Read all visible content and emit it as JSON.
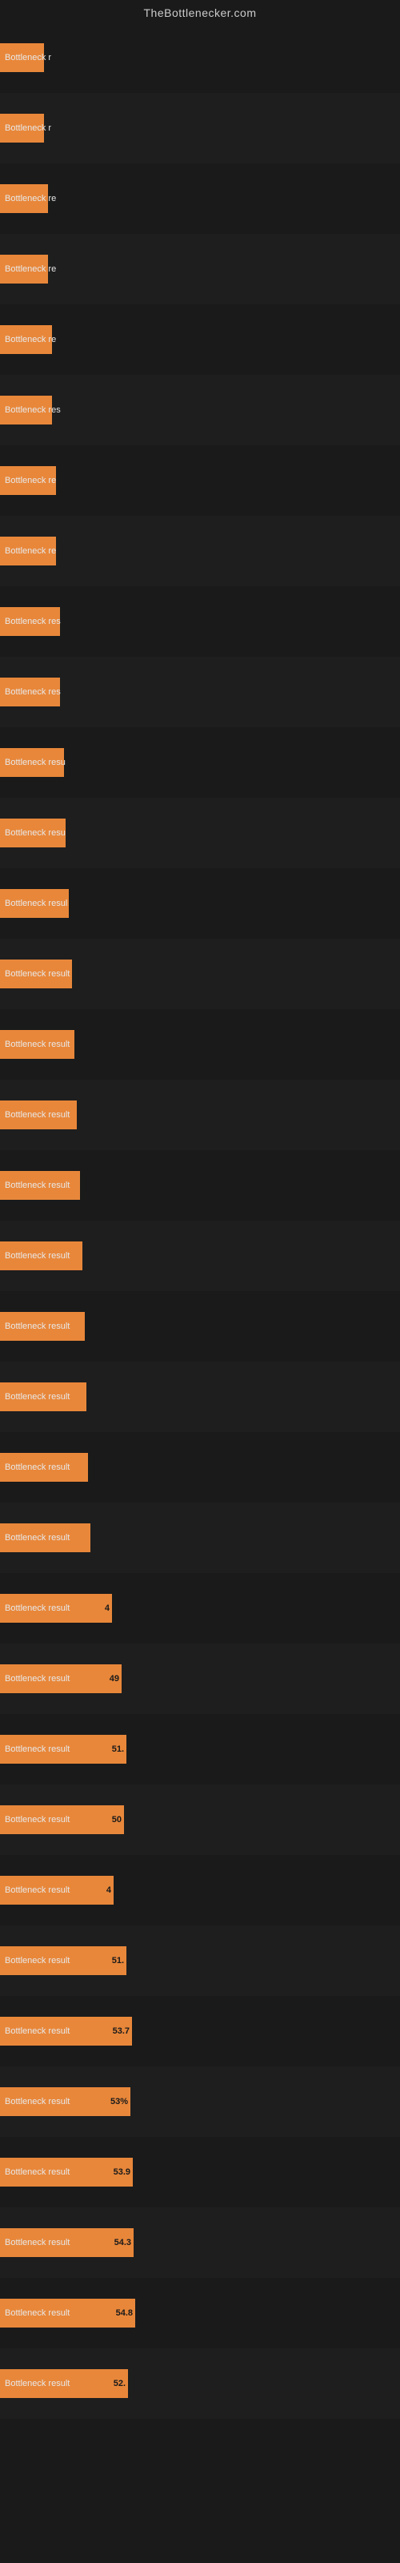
{
  "site": {
    "title": "TheBottlenecker.com"
  },
  "bars": [
    {
      "label": "Bottleneck r",
      "value": null,
      "width": 55
    },
    {
      "label": "Bottleneck r",
      "value": null,
      "width": 55
    },
    {
      "label": "Bottleneck re",
      "value": null,
      "width": 60
    },
    {
      "label": "Bottleneck re",
      "value": null,
      "width": 60
    },
    {
      "label": "Bottleneck re",
      "value": null,
      "width": 65
    },
    {
      "label": "Bottleneck res",
      "value": null,
      "width": 65
    },
    {
      "label": "Bottleneck re",
      "value": null,
      "width": 70
    },
    {
      "label": "Bottleneck re",
      "value": null,
      "width": 70
    },
    {
      "label": "Bottleneck res",
      "value": null,
      "width": 75
    },
    {
      "label": "Bottleneck res",
      "value": null,
      "width": 75
    },
    {
      "label": "Bottleneck resu",
      "value": null,
      "width": 80
    },
    {
      "label": "Bottleneck resu",
      "value": null,
      "width": 82
    },
    {
      "label": "Bottleneck resul",
      "value": null,
      "width": 86
    },
    {
      "label": "Bottleneck result",
      "value": null,
      "width": 90
    },
    {
      "label": "Bottleneck result",
      "value": null,
      "width": 93
    },
    {
      "label": "Bottleneck result",
      "value": null,
      "width": 96
    },
    {
      "label": "Bottleneck result",
      "value": null,
      "width": 100
    },
    {
      "label": "Bottleneck result",
      "value": null,
      "width": 103
    },
    {
      "label": "Bottleneck result",
      "value": null,
      "width": 106
    },
    {
      "label": "Bottleneck result",
      "value": null,
      "width": 108
    },
    {
      "label": "Bottleneck result",
      "value": null,
      "width": 110
    },
    {
      "label": "Bottleneck result",
      "value": null,
      "width": 113
    },
    {
      "label": "Bottleneck result",
      "value": "4",
      "width": 140
    },
    {
      "label": "Bottleneck result",
      "value": "49",
      "width": 152
    },
    {
      "label": "Bottleneck result",
      "value": "51.",
      "width": 158
    },
    {
      "label": "Bottleneck result",
      "value": "50",
      "width": 155
    },
    {
      "label": "Bottleneck result",
      "value": "4",
      "width": 142
    },
    {
      "label": "Bottleneck result",
      "value": "51.",
      "width": 158
    },
    {
      "label": "Bottleneck result",
      "value": "53.7",
      "width": 165
    },
    {
      "label": "Bottleneck result",
      "value": "53%",
      "width": 163
    },
    {
      "label": "Bottleneck result",
      "value": "53.9",
      "width": 166
    },
    {
      "label": "Bottleneck result",
      "value": "54.3",
      "width": 167
    },
    {
      "label": "Bottleneck result",
      "value": "54.8",
      "width": 169
    },
    {
      "label": "Bottleneck result",
      "value": "52.",
      "width": 160
    }
  ]
}
